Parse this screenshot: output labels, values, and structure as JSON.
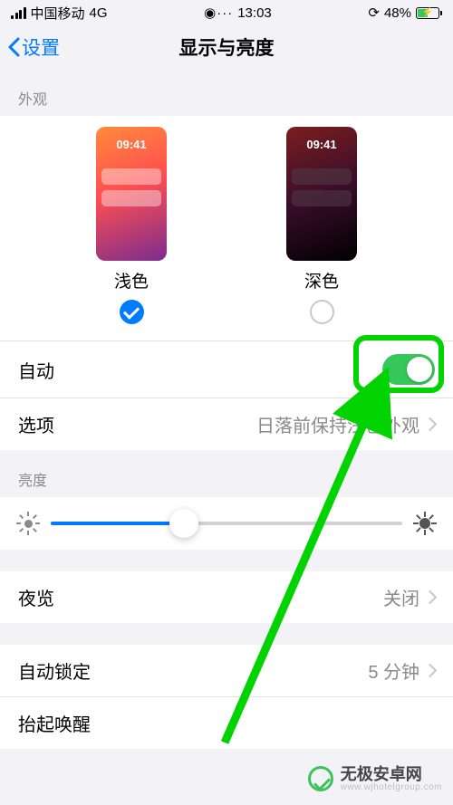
{
  "status": {
    "carrier": "中国移动",
    "net": "4G",
    "time": "13:03",
    "battery_pct": "48%"
  },
  "nav": {
    "back": "设置",
    "title": "显示与亮度"
  },
  "sections": {
    "appearance_header": "外观",
    "brightness_header": "亮度",
    "light": {
      "label": "浅色",
      "preview_time": "09:41"
    },
    "dark": {
      "label": "深色",
      "preview_time": "09:41"
    }
  },
  "rows": {
    "auto": {
      "label": "自动",
      "enabled": true
    },
    "options": {
      "label": "选项",
      "value": "日落前保持浅色外观"
    },
    "night_shift": {
      "label": "夜览",
      "value": "关闭"
    },
    "auto_lock": {
      "label": "自动锁定",
      "value": "5 分钟"
    },
    "raise_wake": {
      "label": "抬起唤醒"
    }
  },
  "brightness": {
    "value": 0.38
  },
  "watermark": {
    "title": "无极安卓网",
    "url": "www.wjhotelgroup.com"
  },
  "colors": {
    "accent": "#007aff",
    "toggle_on": "#34c759",
    "annotation": "#00d300"
  }
}
